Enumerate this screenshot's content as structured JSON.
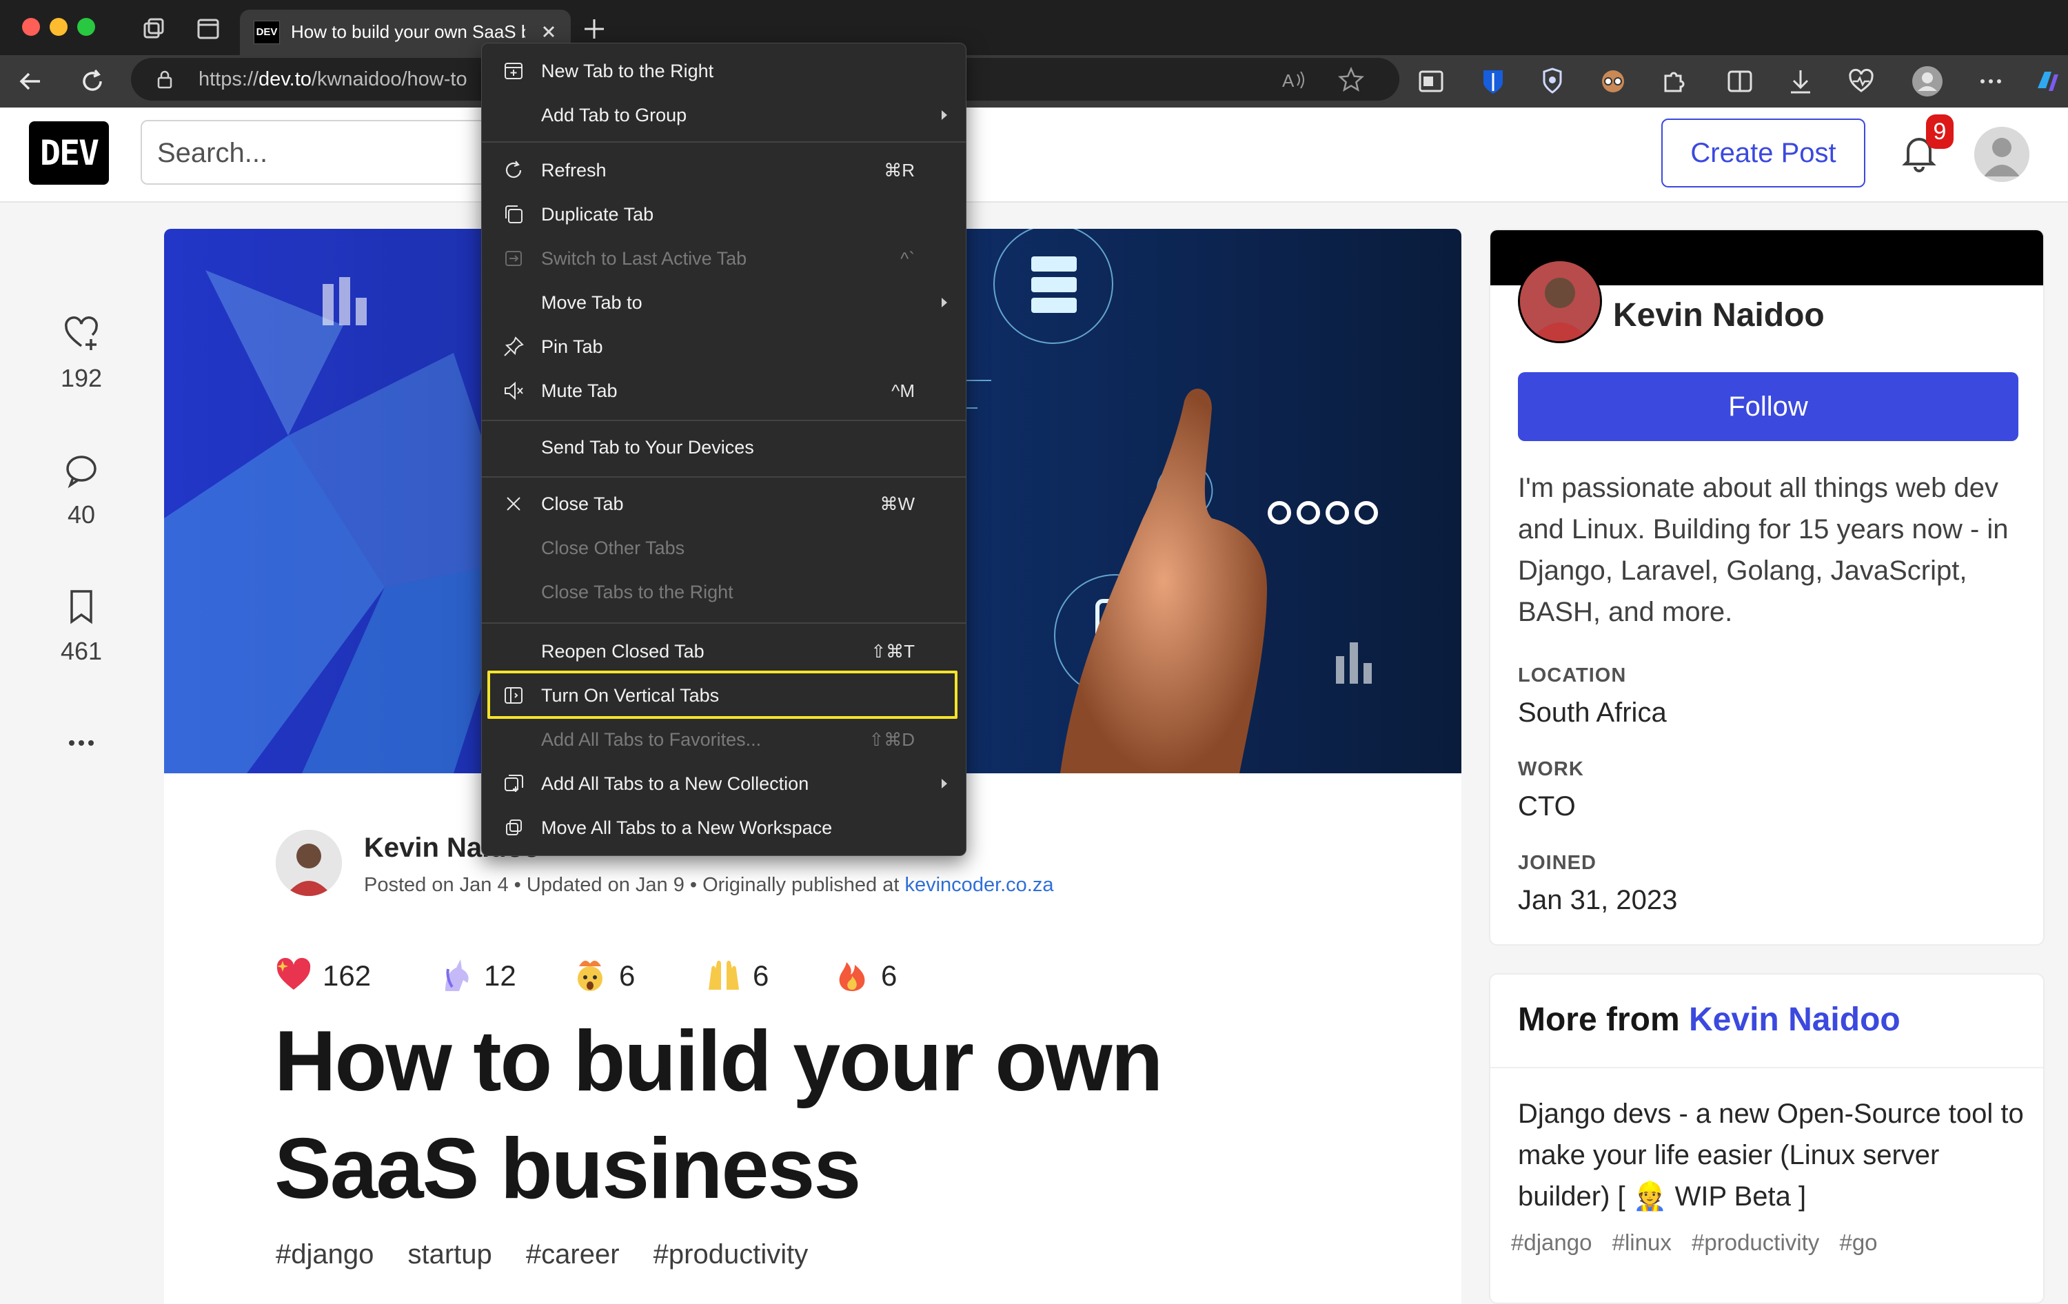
{
  "browser": {
    "tab": {
      "favicon_text": "DEV",
      "title": "How to build your own SaaS business"
    },
    "address": {
      "url_prefix": "https://",
      "url_domain": "dev.to",
      "url_path": "/kwnaidoo/how-to"
    }
  },
  "header": {
    "logo": "DEV",
    "search_placeholder": "Search...",
    "create_post_label": "Create Post",
    "notification_count": "9"
  },
  "rail": {
    "likes": "192",
    "comments": "40",
    "bookmarks": "461"
  },
  "article": {
    "author": "Kevin Naidoo",
    "posted_text": "Posted on Jan 4 • Updated on Jan 9 • Originally published at ",
    "posted_link": "kevincoder.co.za",
    "reactions": [
      {
        "emoji": "sparkle-heart",
        "count": "162"
      },
      {
        "emoji": "unicorn",
        "count": "12"
      },
      {
        "emoji": "exploding-head",
        "count": "6"
      },
      {
        "emoji": "raised-hands",
        "count": "6"
      },
      {
        "emoji": "fire",
        "count": "6"
      }
    ],
    "title_line1": "How to build your own",
    "title_line2": "SaaS business",
    "tags": [
      "#django",
      "startup",
      "#career",
      "#productivity"
    ]
  },
  "profile": {
    "name": "Kevin Naidoo",
    "follow_label": "Follow",
    "bio": "I'm passionate about all things web dev and Linux. Building for 15 years now - in Django, Laravel, Golang, JavaScript, BASH, and more.",
    "location_label": "LOCATION",
    "location": "South Africa",
    "work_label": "WORK",
    "work": "CTO",
    "joined_label": "JOINED",
    "joined": "Jan 31, 2023"
  },
  "more_from": {
    "prefix": "More from ",
    "author": "Kevin Naidoo",
    "article_title": "Django devs - a new Open-Source tool to make your life easier (Linux server builder) [ 👷 WIP Beta ]",
    "tags": [
      "#django",
      "#linux",
      "#productivity",
      "#go"
    ]
  },
  "context_menu": {
    "items": [
      {
        "label": "New Tab to the Right",
        "icon": "new-tab-icon",
        "shortcut": "",
        "disabled": false
      },
      {
        "label": "Add Tab to Group",
        "icon": "",
        "shortcut": "",
        "submenu": true,
        "disabled": false
      },
      {
        "label": "Refresh",
        "icon": "refresh-icon",
        "shortcut": "⌘R",
        "disabled": false
      },
      {
        "label": "Duplicate Tab",
        "icon": "duplicate-icon",
        "shortcut": "",
        "disabled": false
      },
      {
        "label": "Switch to Last Active Tab",
        "icon": "switch-tab-icon",
        "shortcut": "^`",
        "disabled": true
      },
      {
        "label": "Move Tab to",
        "icon": "",
        "shortcut": "",
        "submenu": true,
        "disabled": false
      },
      {
        "label": "Pin Tab",
        "icon": "pin-icon",
        "shortcut": "",
        "disabled": false
      },
      {
        "label": "Mute Tab",
        "icon": "mute-icon",
        "shortcut": "^M",
        "disabled": false
      },
      {
        "label": "Send Tab to Your Devices",
        "icon": "",
        "shortcut": "",
        "disabled": false
      },
      {
        "label": "Close Tab",
        "icon": "close-icon",
        "shortcut": "⌘W",
        "disabled": false
      },
      {
        "label": "Close Other Tabs",
        "icon": "",
        "shortcut": "",
        "disabled": true
      },
      {
        "label": "Close Tabs to the Right",
        "icon": "",
        "shortcut": "",
        "disabled": true
      },
      {
        "label": "Reopen Closed Tab",
        "icon": "",
        "shortcut": "⇧⌘T",
        "disabled": false
      },
      {
        "label": "Turn On Vertical Tabs",
        "icon": "vertical-tabs-icon",
        "shortcut": "",
        "disabled": false,
        "highlighted": true
      },
      {
        "label": "Add All Tabs to Favorites...",
        "icon": "",
        "shortcut": "⇧⌘D",
        "disabled": true
      },
      {
        "label": "Add All Tabs to a New Collection",
        "icon": "collection-icon",
        "shortcut": "",
        "submenu": true,
        "disabled": false
      },
      {
        "label": "Move All Tabs to a New Workspace",
        "icon": "workspace-icon",
        "shortcut": "",
        "disabled": false
      }
    ]
  }
}
